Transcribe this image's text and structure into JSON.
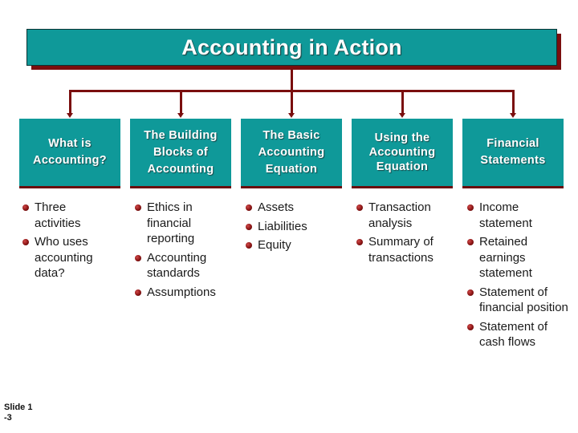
{
  "title": "Accounting in Action",
  "colors": {
    "teal": "#0f9999",
    "dark_red": "#7a0e0e",
    "text": "#1a1a1a"
  },
  "categories": [
    {
      "label": "What is\nAccounting?",
      "items": [
        "Three activities",
        "Who uses accounting data?"
      ]
    },
    {
      "label": "The Building\nBlocks of\nAccounting",
      "items": [
        "Ethics in financial reporting",
        "Accounting standards",
        "Assumptions"
      ]
    },
    {
      "label": "The Basic\nAccounting\nEquation",
      "items": [
        "Assets",
        "Liabilities",
        "Equity"
      ]
    },
    {
      "label": "Using the\nAccounting\nEquation",
      "items": [
        "Transaction analysis",
        "Summary of transactions"
      ]
    },
    {
      "label": "Financial\nStatements",
      "items": [
        "Income statement",
        "Retained earnings statement",
        "Statement of financial position",
        "Statement of cash flows"
      ]
    }
  ],
  "slide_number": "Slide 1\n-3"
}
